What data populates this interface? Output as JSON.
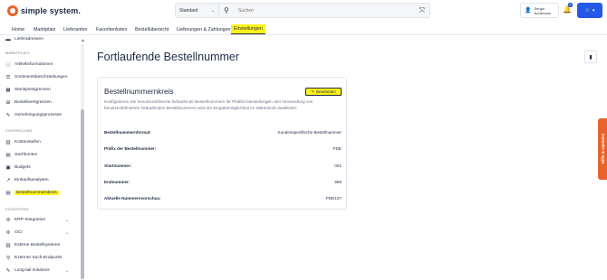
{
  "header": {
    "logo_text": "simple system.",
    "search": {
      "scope": "Standard",
      "placeholder": "Suchen"
    },
    "user": {
      "line1": "Sergio",
      "line2": "Nordmann"
    },
    "notification_count": "5"
  },
  "nav": {
    "items": [
      "Home",
      "Marktplatz",
      "Lieferanten",
      "Favoritenlisten",
      "Bestellübersicht",
      "Lieferungen & Zahlungen",
      "Einstellungen"
    ],
    "active": "Einstellungen"
  },
  "sidebar": {
    "top_item": "Lieferadressen",
    "sections": [
      {
        "title": "MARKTPLATZ",
        "items": [
          "Artikelinformationen",
          "Sortimentsbeschränkungen",
          "Stückpreisgrenzen",
          "Bestellwertgrenzen",
          "Genehmigungsprozesse"
        ]
      },
      {
        "title": "CONTROLLING",
        "items": [
          "Kostenstellen",
          "Sachkonten",
          "Budgets",
          "Einkaufsanalysen",
          "Bestellnummernkreis"
        ]
      },
      {
        "title": "ECOSYSTEM",
        "items": [
          "ERP-Integration",
          "OCI",
          "Externe Bestellsysteme",
          "Externer Such-Endpunkt",
          "Long-tail solutions"
        ]
      }
    ],
    "active_item": "Bestellnummernkreis"
  },
  "main": {
    "title": "Fortlaufende Bestellnummer",
    "card": {
      "title": "Bestellnummernkreis",
      "edit_label": "Bearbeiten",
      "description": "Konfigurieren Sie benutzerdefinierte fortlaufende Bestellnummern für Plattformbestellungen. Bei Verwendung von benutzerdefinierten fortlaufenden Bestellnummern wird die Eingabemöglichkeit im Warenkorb deaktiviert.",
      "rows": [
        {
          "label": "Bestellnummernformat:",
          "value": "Kundenspezifische Bestellnummer"
        },
        {
          "label": "Präfix der Bestellnummer:",
          "value": "PDE"
        },
        {
          "label": "Startnummer:",
          "value": "001"
        },
        {
          "label": "Endnummer:",
          "value": "999"
        },
        {
          "label": "Aktuelle Nummernvorschau:",
          "value": "PDE107"
        }
      ]
    }
  },
  "help_tab": {
    "label": "Hilfe & Updates"
  },
  "colors": {
    "accent_yellow": "#fff21b",
    "brand_orange": "#e8632b",
    "primary_blue": "#2358e8",
    "text_dark": "#1f2a44"
  }
}
